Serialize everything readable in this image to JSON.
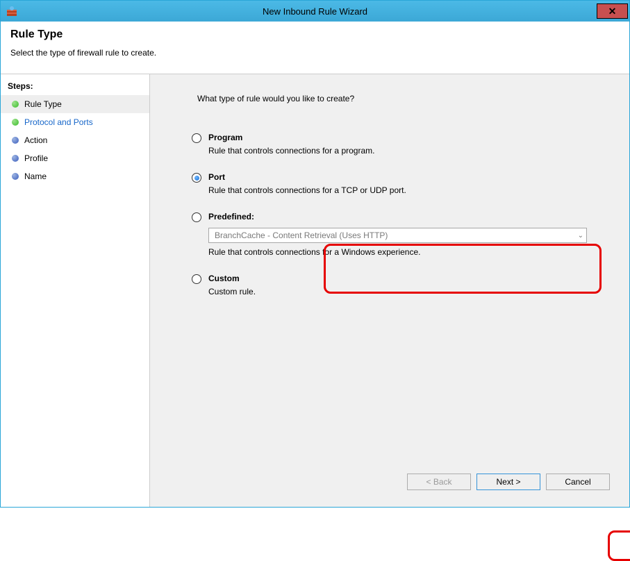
{
  "window": {
    "title": "New Inbound Rule Wizard"
  },
  "header": {
    "title": "Rule Type",
    "subtitle": "Select the type of firewall rule to create."
  },
  "sidebar": {
    "steps_label": "Steps:",
    "steps": [
      {
        "label": "Rule Type",
        "current": true,
        "link": false
      },
      {
        "label": "Protocol and Ports",
        "current": false,
        "link": true
      },
      {
        "label": "Action",
        "current": false,
        "link": false
      },
      {
        "label": "Profile",
        "current": false,
        "link": false
      },
      {
        "label": "Name",
        "current": false,
        "link": false
      }
    ]
  },
  "main": {
    "prompt": "What type of rule would you like to create?",
    "options": {
      "program": {
        "label": "Program",
        "desc": "Rule that controls connections for a program."
      },
      "port": {
        "label": "Port",
        "desc": "Rule that controls connections for a TCP or UDP port."
      },
      "predefined": {
        "label": "Predefined:",
        "desc": "Rule that controls connections for a Windows experience.",
        "dropdown": "BranchCache - Content Retrieval (Uses HTTP)"
      },
      "custom": {
        "label": "Custom",
        "desc": "Custom rule."
      }
    }
  },
  "buttons": {
    "back": "< Back",
    "next": "Next >",
    "cancel": "Cancel"
  }
}
